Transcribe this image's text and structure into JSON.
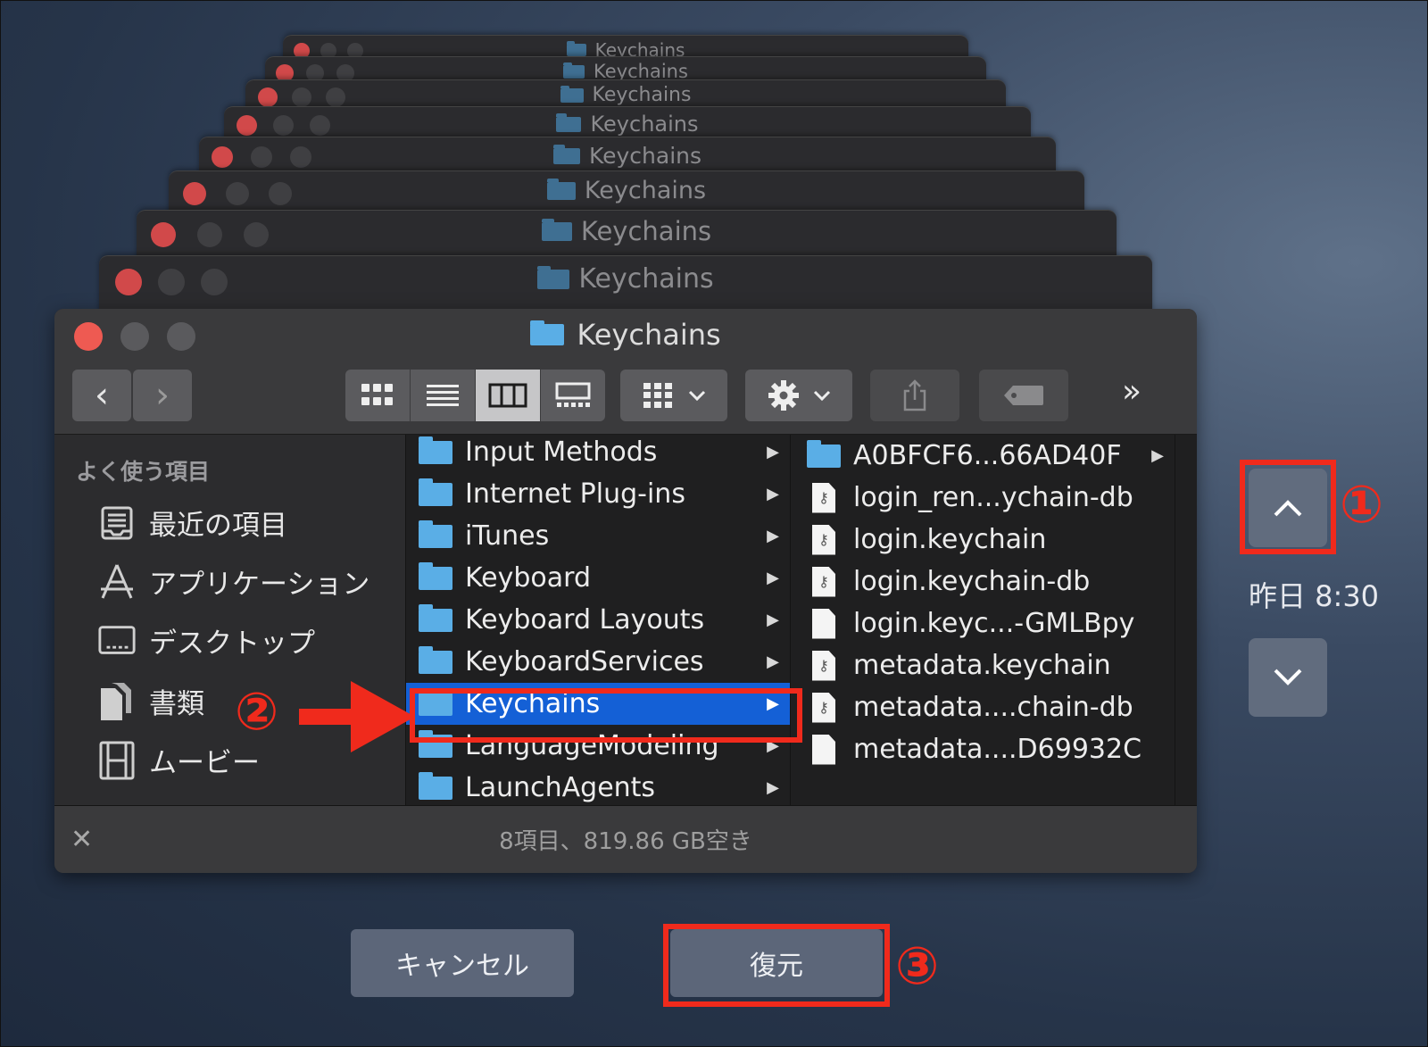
{
  "window_title": "Keychains",
  "toolbar": {
    "nav_back": "‹",
    "nav_forward": "›",
    "more": "»",
    "view_icons": [
      "icon-view-icon",
      "list-view-icon",
      "column-view-icon",
      "gallery-view-icon"
    ],
    "active_view": "column"
  },
  "sidebar": {
    "heading": "よく使う項目",
    "items": [
      {
        "label": "最近の項目",
        "icon": "recents-icon"
      },
      {
        "label": "アプリケーション",
        "icon": "applications-icon"
      },
      {
        "label": "デスクトップ",
        "icon": "desktop-icon"
      },
      {
        "label": "書類",
        "icon": "documents-icon"
      },
      {
        "label": "ムービー",
        "icon": "movies-icon"
      }
    ]
  },
  "column_folders": [
    {
      "label": "Input Methods"
    },
    {
      "label": "Internet Plug-ins"
    },
    {
      "label": "iTunes"
    },
    {
      "label": "Keyboard"
    },
    {
      "label": "Keyboard Layouts"
    },
    {
      "label": "KeyboardServices"
    },
    {
      "label": "Keychains",
      "selected": true
    },
    {
      "label": "LanguageModeling"
    },
    {
      "label": "LaunchAgents"
    }
  ],
  "column_files": [
    {
      "label": "A0BFCF6...66AD40F",
      "icon": "folder-icon"
    },
    {
      "label": "login_ren...ychain-db",
      "icon": "keychain-file-icon"
    },
    {
      "label": "login.keychain",
      "icon": "keychain-file-icon"
    },
    {
      "label": "login.keychain-db",
      "icon": "keychain-file-icon"
    },
    {
      "label": "login.keyc...-GMLBpy",
      "icon": "blank-file-icon"
    },
    {
      "label": "metadata.keychain",
      "icon": "keychain-file-icon"
    },
    {
      "label": "metadata....chain-db",
      "icon": "keychain-file-icon"
    },
    {
      "label": "metadata....D69932C",
      "icon": "blank-file-icon"
    }
  ],
  "status_bar": "8項目、819.86 GB空き",
  "time_machine": {
    "timestamp": "昨日 8:30",
    "up_icon": "chevron-up-icon",
    "down_icon": "chevron-down-icon"
  },
  "buttons": {
    "cancel": "キャンセル",
    "restore": "復元"
  },
  "annotations": {
    "one": "①",
    "two": "②",
    "three": "③"
  },
  "colors": {
    "highlight_red": "#f02a1c",
    "selection_blue": "#1460d6",
    "folder_blue": "#5aaee6"
  }
}
